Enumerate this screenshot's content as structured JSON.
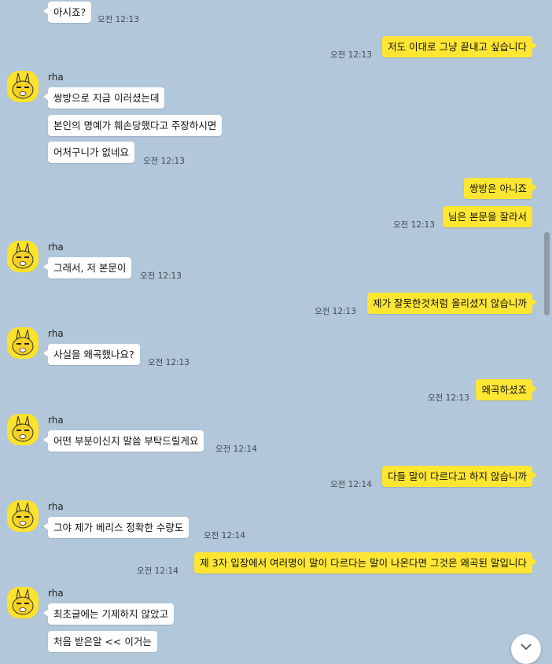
{
  "colors": {
    "background": "#b2c7d9",
    "incoming_bubble": "#ffffff",
    "outgoing_bubble": "#fee633",
    "avatar": "#fbe22b"
  },
  "icons": {
    "avatar": "character-avatar-icon",
    "scroll_down": "chevron-down-icon"
  },
  "messages": [
    {
      "dir": "in",
      "text": "아시죠?",
      "time": "오전 12:13"
    },
    {
      "dir": "out",
      "text": "저도 이대로 그냥 끝내고 싶습니다",
      "time": "오전 12:13"
    },
    {
      "dir": "in",
      "sender": "rha",
      "text": "쌍방으로 지금 이러셨는데"
    },
    {
      "dir": "in",
      "text": "본인의 명예가 훼손당했다고 주장하시면"
    },
    {
      "dir": "in",
      "text": "어처구니가 없네요",
      "time": "오전 12:13"
    },
    {
      "dir": "out",
      "text": "쌍방은 아니죠"
    },
    {
      "dir": "out",
      "text": "님은 본문을 잘라서",
      "time": "오전 12:13"
    },
    {
      "dir": "in",
      "sender": "rha",
      "text": "그래서, 저 본문이",
      "time": "오전 12:13"
    },
    {
      "dir": "out",
      "text": "제가 잘못한것처럼 올리셨지 않습니까",
      "time": "오전 12:13"
    },
    {
      "dir": "in",
      "sender": "rha",
      "text": "사실을 왜곡했나요?",
      "time": "오전 12:13"
    },
    {
      "dir": "out",
      "text": "왜곡하셨죠",
      "time": "오전 12:13"
    },
    {
      "dir": "in",
      "sender": "rha",
      "text": "어떤 부분이신지 말씀 부탁드릴게요",
      "time": "오전 12:14"
    },
    {
      "dir": "out",
      "text": "다들 말이 다르다고 하지 않습니까",
      "time": "오전 12:14"
    },
    {
      "dir": "in",
      "sender": "rha",
      "text": "그야 제가 베리스 정확한 수량도",
      "time": "오전 12:14"
    },
    {
      "dir": "out",
      "text": "제 3자 입장에서 여러명이 말이 다르다는 말이 나온다면 그것은 왜곡된 말입니다",
      "time": "오전 12:14"
    },
    {
      "dir": "in",
      "sender": "rha",
      "text": "최초글에는 기제하지 않았고"
    },
    {
      "dir": "in",
      "text": "처음 받은알 << 이거는"
    }
  ]
}
